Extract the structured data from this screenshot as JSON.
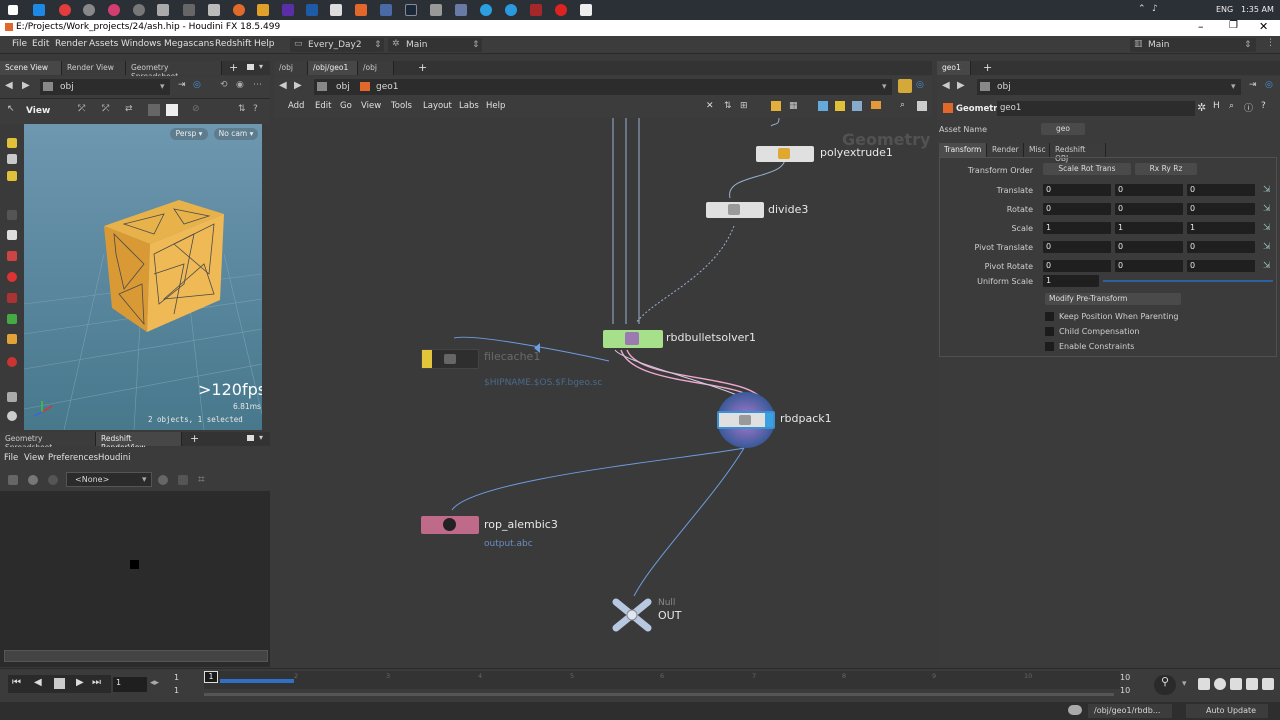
{
  "taskbar": {
    "lang": "ENG",
    "time": "1:35 AM"
  },
  "window": {
    "title": "E:/Projects/Work_projects/24/ash.hip - Houdini FX 18.5.499"
  },
  "menubar": {
    "items": [
      "File",
      "Edit",
      "Render",
      "Assets",
      "Windows",
      "Megascans",
      "Redshift",
      "Help"
    ],
    "desktop": "Every_Day2",
    "main_label": "Main",
    "right_label": "Main"
  },
  "left_tabs": {
    "scene_view": "Scene View",
    "render_view": "Render View",
    "geo_spreadsheet": "Geometry Spreadsheet"
  },
  "viewport": {
    "path": "obj",
    "view_label": "View",
    "persp": "Persp ▾",
    "cam": "No cam ▾",
    "fps": ">120fps",
    "ms": "6.81ms",
    "status": "2 objects, 1 selected"
  },
  "lower_left": {
    "tab1": "Geometry Spreadsheet",
    "tab2": "Redshift RenderView",
    "menu": [
      "File",
      "View",
      "Preferences",
      "Houdini"
    ],
    "none_select": "<None>"
  },
  "network": {
    "tabs": [
      "/obj",
      "/obj/geo1",
      "/obj"
    ],
    "path_root": "obj",
    "path_child": "geo1",
    "menu": [
      "Add",
      "Edit",
      "Go",
      "View",
      "Tools",
      "Layout",
      "Labs",
      "Help"
    ],
    "watermark": "Geometry",
    "nodes": {
      "polyextrude": "polyextrude1",
      "divide": "divide3",
      "solver": "rbdbulletsolver1",
      "filecache": "filecache1",
      "filecache_path": "$HIPNAME.$OS.$F.bgeo.sc",
      "rbdpack": "rbdpack1",
      "rop": "rop_alembic3",
      "rop_file": "output.abc",
      "null_type": "Null",
      "null_name": "OUT"
    }
  },
  "params": {
    "tab": "geo1",
    "path": "obj",
    "node_type": "Geometry",
    "node_name": "geo1",
    "asset_label": "Asset Name",
    "asset_value": "geo",
    "tabs": [
      "Transform",
      "Render",
      "Misc",
      "Redshift OBJ"
    ],
    "transform_order_label": "Transform Order",
    "transform_order": "Scale Rot Trans",
    "rot_order": "Rx Ry Rz",
    "rows": [
      {
        "label": "Translate",
        "v": [
          "0",
          "0",
          "0"
        ]
      },
      {
        "label": "Rotate",
        "v": [
          "0",
          "0",
          "0"
        ]
      },
      {
        "label": "Scale",
        "v": [
          "1",
          "1",
          "1"
        ]
      },
      {
        "label": "Pivot Translate",
        "v": [
          "0",
          "0",
          "0"
        ]
      },
      {
        "label": "Pivot Rotate",
        "v": [
          "0",
          "0",
          "0"
        ]
      }
    ],
    "uniform_label": "Uniform Scale",
    "uniform_value": "1",
    "modify_btn": "Modify Pre-Transform",
    "checks": [
      "Keep Position When Parenting",
      "Child Compensation",
      "Enable Constraints"
    ]
  },
  "timeline": {
    "frame": "1",
    "start1": "1",
    "start2": "1",
    "end1": "10",
    "end2": "10",
    "ticks": [
      "1",
      "2",
      "3",
      "4",
      "5",
      "6",
      "7",
      "8",
      "9",
      "10"
    ],
    "status_path": "/obj/geo1/rbdb...",
    "auto_update": "Auto Update"
  },
  "colors": {
    "accent": "#2f6fc6",
    "solver": "#a6e08a",
    "rop": "#c06a8a",
    "filecache": "#e2c53a",
    "pack": "#3a90d0"
  }
}
